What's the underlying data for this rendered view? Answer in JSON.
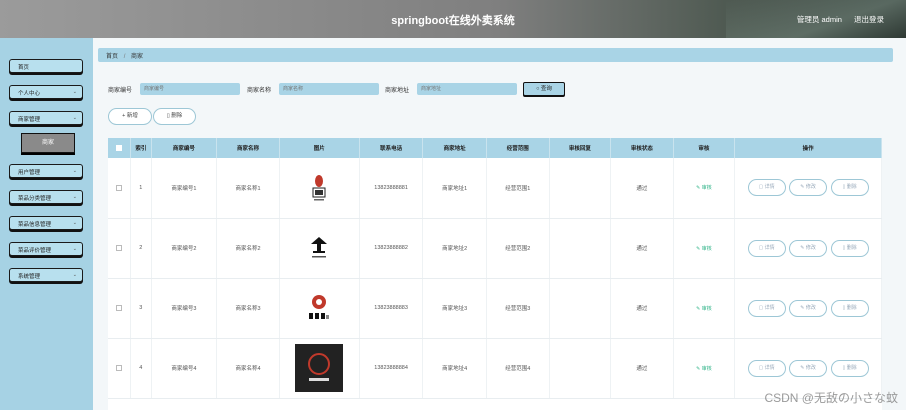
{
  "header": {
    "title": "springboot在线外卖系统",
    "user_label": "管理员 admin",
    "logout": "退出登录"
  },
  "sidebar": {
    "items": [
      {
        "label": "首页",
        "has_chevron": false
      },
      {
        "label": "个人中心",
        "has_chevron": true
      },
      {
        "label": "商家管理",
        "has_chevron": true
      },
      {
        "label": "用户管理",
        "has_chevron": true
      },
      {
        "label": "菜品分类管理",
        "has_chevron": true
      },
      {
        "label": "菜品信息管理",
        "has_chevron": true
      },
      {
        "label": "菜品评价管理",
        "has_chevron": true
      },
      {
        "label": "系统管理",
        "has_chevron": true
      }
    ],
    "active_sub": "商家"
  },
  "breadcrumb": {
    "home": "首页",
    "current": "商家"
  },
  "search": {
    "fields": [
      {
        "label": "商家编号",
        "placeholder": "商家编号"
      },
      {
        "label": "商家名称",
        "placeholder": "商家名称"
      },
      {
        "label": "商家地址",
        "placeholder": "商家地址"
      }
    ],
    "query_button": "查询"
  },
  "toolbar": {
    "add": "+ 新增",
    "delete": "删除"
  },
  "table": {
    "columns": [
      "索引",
      "商家编号",
      "商家名称",
      "图片",
      "联系电话",
      "商家地址",
      "经营范围",
      "审核回复",
      "审核状态",
      "审核",
      "操作"
    ],
    "rows": [
      {
        "index": "1",
        "code": "商家编号1",
        "name": "商家名称1",
        "image": "logo-1",
        "phone": "13823888881",
        "address": "商家地址1",
        "scope": "经营范围1",
        "reply": "",
        "status": "通过",
        "audit": "审核"
      },
      {
        "index": "2",
        "code": "商家编号2",
        "name": "商家名称2",
        "image": "logo-2",
        "phone": "13823888882",
        "address": "商家地址2",
        "scope": "经营范围2",
        "reply": "",
        "status": "通过",
        "audit": "审核"
      },
      {
        "index": "3",
        "code": "商家编号3",
        "name": "商家名称3",
        "image": "logo-3",
        "phone": "13823888883",
        "address": "商家地址3",
        "scope": "经营范围3",
        "reply": "",
        "status": "通过",
        "audit": "审核"
      },
      {
        "index": "4",
        "code": "商家编号4",
        "name": "商家名称4",
        "image": "logo-4",
        "phone": "13823888884",
        "address": "商家地址4",
        "scope": "经营范围4",
        "reply": "",
        "status": "通过",
        "audit": "审核"
      }
    ],
    "actions": {
      "detail": "详情",
      "edit": "修改",
      "delete": "删除"
    }
  },
  "watermark": "CSDN @无敌の小さな蚊",
  "colors": {
    "accent": "#a9d4e6",
    "sidebar_bg": "#a6d2e4",
    "audit_green": "#33b58a"
  }
}
